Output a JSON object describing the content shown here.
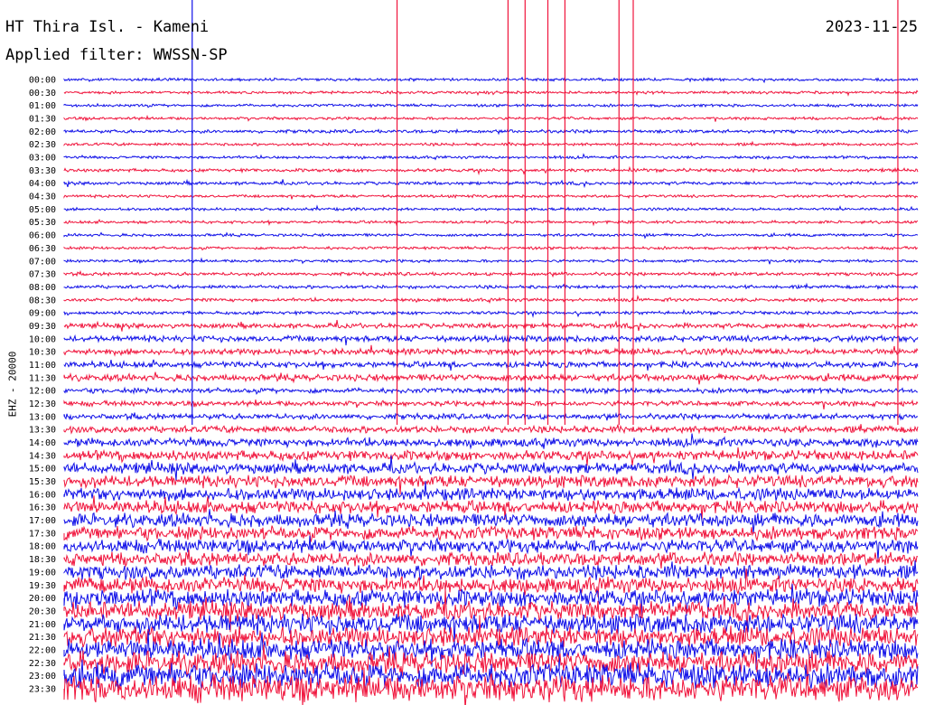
{
  "header": {
    "station": "HT Thira Isl. - Kameni",
    "filter_label": "Applied filter:",
    "filter_value": "WWSSN-SP",
    "date": "2023-11-25"
  },
  "chart_data": {
    "type": "line",
    "title": "HT Thira Isl. - Kameni",
    "ylabel": "EHZ - 20000",
    "xlabel": "",
    "colors": {
      "even_trace": "#1010e8",
      "odd_trace": "#f0143c"
    },
    "tick_labels": [
      "00:00",
      "00:30",
      "01:00",
      "01:30",
      "02:00",
      "02:30",
      "03:00",
      "03:30",
      "04:00",
      "04:30",
      "05:00",
      "05:30",
      "06:00",
      "06:30",
      "07:00",
      "07:30",
      "08:00",
      "08:30",
      "09:00",
      "09:30",
      "10:00",
      "10:30",
      "11:00",
      "11:30",
      "12:00",
      "12:30",
      "13:00",
      "13:30",
      "14:00",
      "14:30",
      "15:00",
      "15:30",
      "16:00",
      "16:30",
      "17:00",
      "17:30",
      "18:00",
      "18:30",
      "19:00",
      "19:30",
      "20:00",
      "20:30",
      "21:00",
      "21:30",
      "22:00",
      "22:30",
      "23:00",
      "23:30"
    ],
    "amplitude_by_row": [
      0.25,
      0.25,
      0.25,
      0.25,
      0.3,
      0.25,
      0.25,
      0.3,
      0.3,
      0.25,
      0.25,
      0.25,
      0.25,
      0.25,
      0.25,
      0.3,
      0.3,
      0.3,
      0.3,
      0.45,
      0.55,
      0.55,
      0.55,
      0.6,
      0.45,
      0.45,
      0.5,
      0.6,
      0.75,
      0.9,
      1.0,
      1.1,
      1.1,
      1.15,
      1.2,
      1.2,
      1.2,
      1.2,
      1.3,
      1.4,
      1.6,
      1.7,
      1.8,
      1.8,
      1.9,
      2.0,
      2.2,
      2.4
    ],
    "spikes": [
      {
        "time": "00:00",
        "offset_min": 4.5,
        "color": "blue"
      },
      {
        "time": "00:00",
        "offset_min": 11.7,
        "color": "red"
      },
      {
        "time": "00:00",
        "offset_min": 15.6,
        "color": "red"
      },
      {
        "time": "00:00",
        "offset_min": 16.2,
        "color": "red"
      },
      {
        "time": "00:00",
        "offset_min": 17.0,
        "color": "red"
      },
      {
        "time": "00:00",
        "offset_min": 17.6,
        "color": "red"
      },
      {
        "time": "00:00",
        "offset_min": 19.5,
        "color": "red"
      },
      {
        "time": "00:00",
        "offset_min": 20.0,
        "color": "red"
      },
      {
        "time": "00:00",
        "offset_min": 29.3,
        "color": "red"
      }
    ]
  }
}
